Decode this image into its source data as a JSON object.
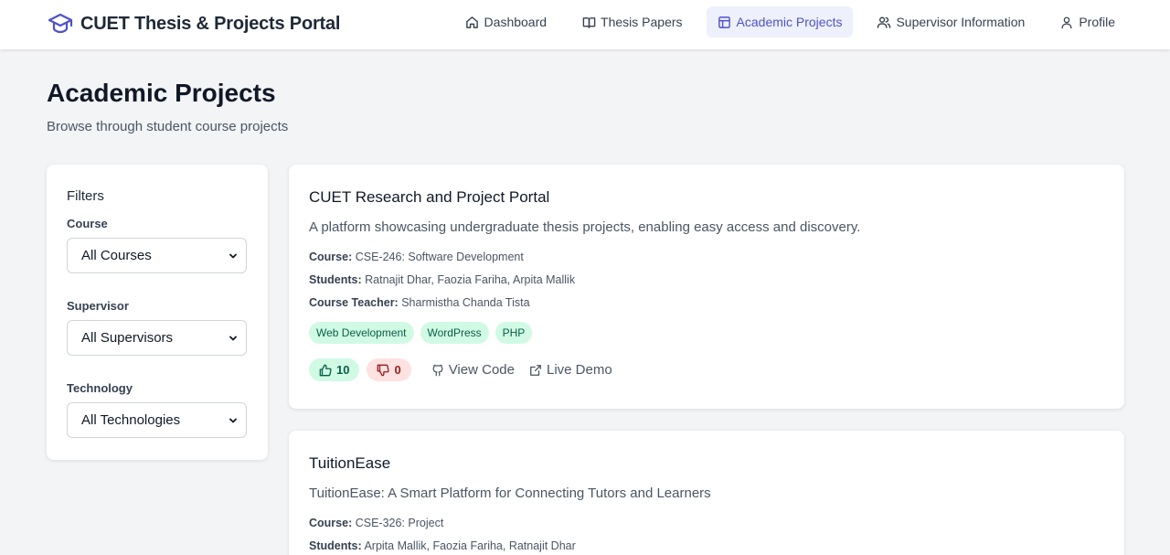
{
  "app": {
    "title": "CUET Thesis & Projects Portal",
    "logo_icon": "graduation-cap-icon",
    "accent": "#4f52c9"
  },
  "nav": {
    "items": [
      {
        "label": "Dashboard",
        "icon": "home-icon",
        "active": false
      },
      {
        "label": "Thesis Papers",
        "icon": "book-icon",
        "active": false
      },
      {
        "label": "Academic Projects",
        "icon": "layout-icon",
        "active": true
      },
      {
        "label": "Supervisor Information",
        "icon": "users-icon",
        "active": false
      },
      {
        "label": "Profile",
        "icon": "user-icon",
        "active": false
      }
    ]
  },
  "page": {
    "title": "Academic Projects",
    "subtitle": "Browse through student course projects"
  },
  "filters": {
    "title": "Filters",
    "course": {
      "label": "Course",
      "value": "All Courses"
    },
    "supervisor": {
      "label": "Supervisor",
      "value": "All Supervisors"
    },
    "technology": {
      "label": "Technology",
      "value": "All Technologies"
    }
  },
  "labels": {
    "course": "Course:",
    "students": "Students:",
    "teacher": "Course Teacher:"
  },
  "projects": [
    {
      "title": "CUET Research and Project Portal",
      "description": "A platform showcasing undergraduate thesis projects, enabling easy access and discovery.",
      "course": "CSE-246: Software Development",
      "students": "Ratnajit Dhar, Faozia Fariha, Arpita Mallik",
      "teacher": "Sharmistha Chanda Tista",
      "tags": [
        "Web Development",
        "WordPress",
        "PHP"
      ],
      "upvotes": "10",
      "downvotes": "0",
      "view_code": "View Code",
      "live_demo": "Live Demo"
    },
    {
      "title": "TuitionEase",
      "description": "TuitionEase: A Smart Platform for Connecting Tutors and Learners",
      "course": "CSE-326: Project",
      "students": "Arpita Mallik, Faozia Fariha, Ratnajit Dhar"
    }
  ]
}
